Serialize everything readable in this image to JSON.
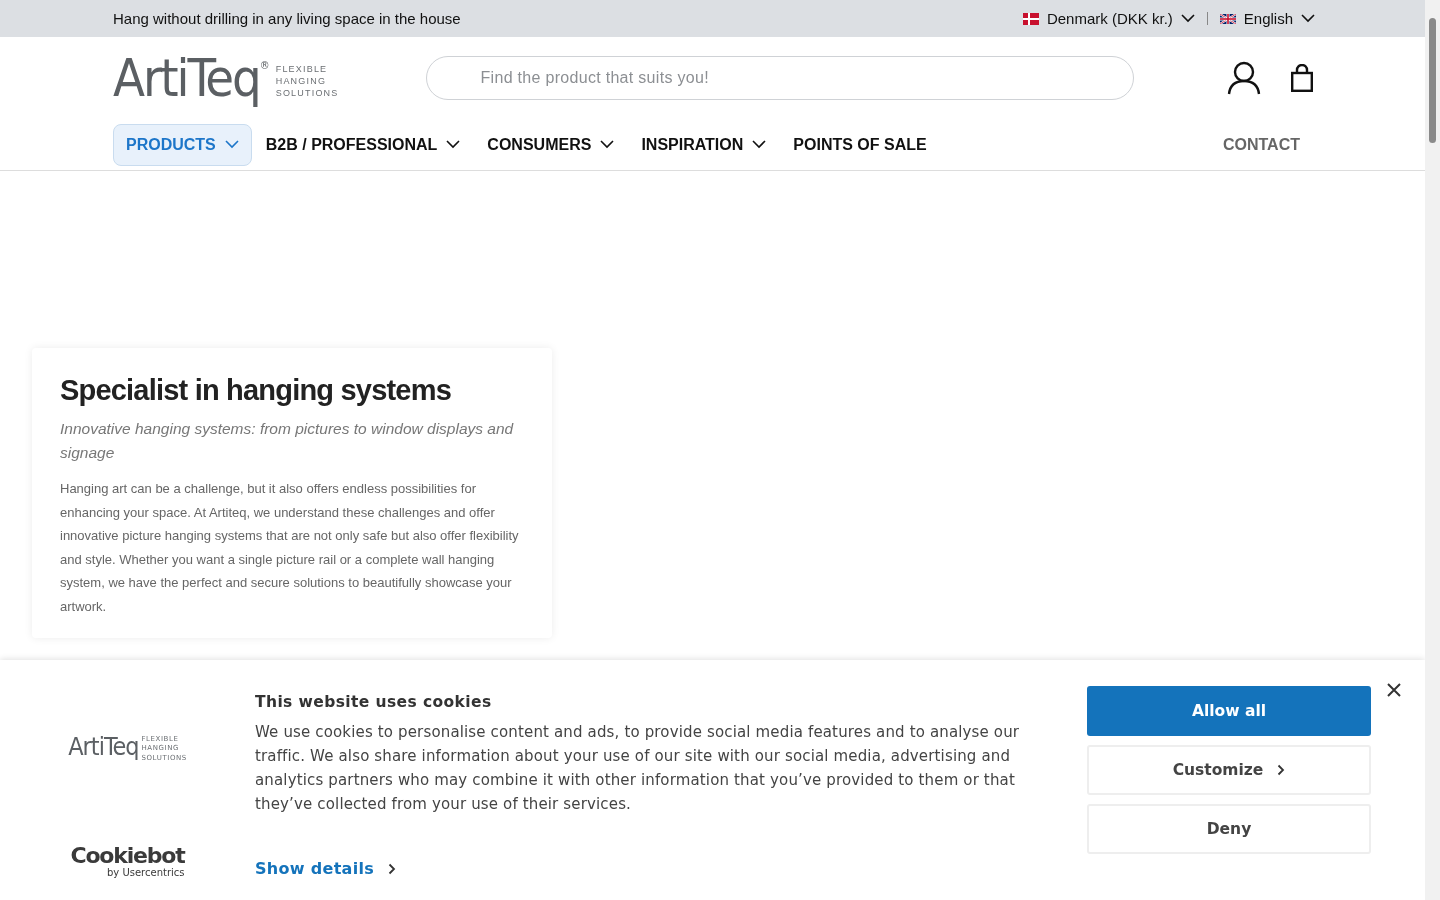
{
  "top_bar": {
    "tagline": "Hang without drilling in any living space in the house",
    "country": "Denmark (DKK kr.)",
    "language": "English"
  },
  "header": {
    "logo": {
      "name": "ArtiTeq",
      "mark": "®",
      "slogan": [
        "FLEXIBLE",
        "HANGING",
        "SOLUTIONS"
      ]
    },
    "search": {
      "placeholder": "Find the product that suits you!"
    }
  },
  "nav": {
    "items": [
      {
        "label": "PRODUCTS",
        "selected": true,
        "has_menu": true
      },
      {
        "label": "B2B / PROFESSIONAL",
        "selected": false,
        "has_menu": true
      },
      {
        "label": "CONSUMERS",
        "selected": false,
        "has_menu": true
      },
      {
        "label": "INSPIRATION",
        "selected": false,
        "has_menu": true
      },
      {
        "label": "POINTS OF SALE",
        "selected": false,
        "has_menu": false
      }
    ],
    "contact": "CONTACT"
  },
  "hero": {
    "title": "Specialist in hanging systems",
    "subtitle": "Innovative hanging systems: from pictures to window displays and signage",
    "body": "Hanging art can be a challenge, but it also offers endless possibilities for enhancing your space. At Artiteq, we understand these challenges and offer innovative picture hanging systems that are not only safe but also offer flexibility and style. Whether you want a single picture rail or a complete wall hanging system, we have the perfect and secure solutions to beautifully showcase your artwork."
  },
  "cookie_banner": {
    "logo": {
      "name": "ArtiTeq",
      "slogan": [
        "FLEXIBLE",
        "HANGING",
        "SOLUTIONS"
      ]
    },
    "provider": {
      "name": "Cookiebot",
      "byline": "by Usercentrics"
    },
    "title": "This website uses cookies",
    "text": "We use cookies to personalise content and ads, to provide social media features and to analyse our traffic. We also share information about your use of our site with our social media, advertising and analytics partners who may combine it with other information that you’ve provided to them or that they’ve collected from your use of their services.",
    "details_link": "Show details",
    "buttons": [
      {
        "label": "Allow all",
        "kind": "primary"
      },
      {
        "label": "Customize",
        "kind": "more"
      },
      {
        "label": "Deny",
        "kind": "plain"
      }
    ]
  }
}
